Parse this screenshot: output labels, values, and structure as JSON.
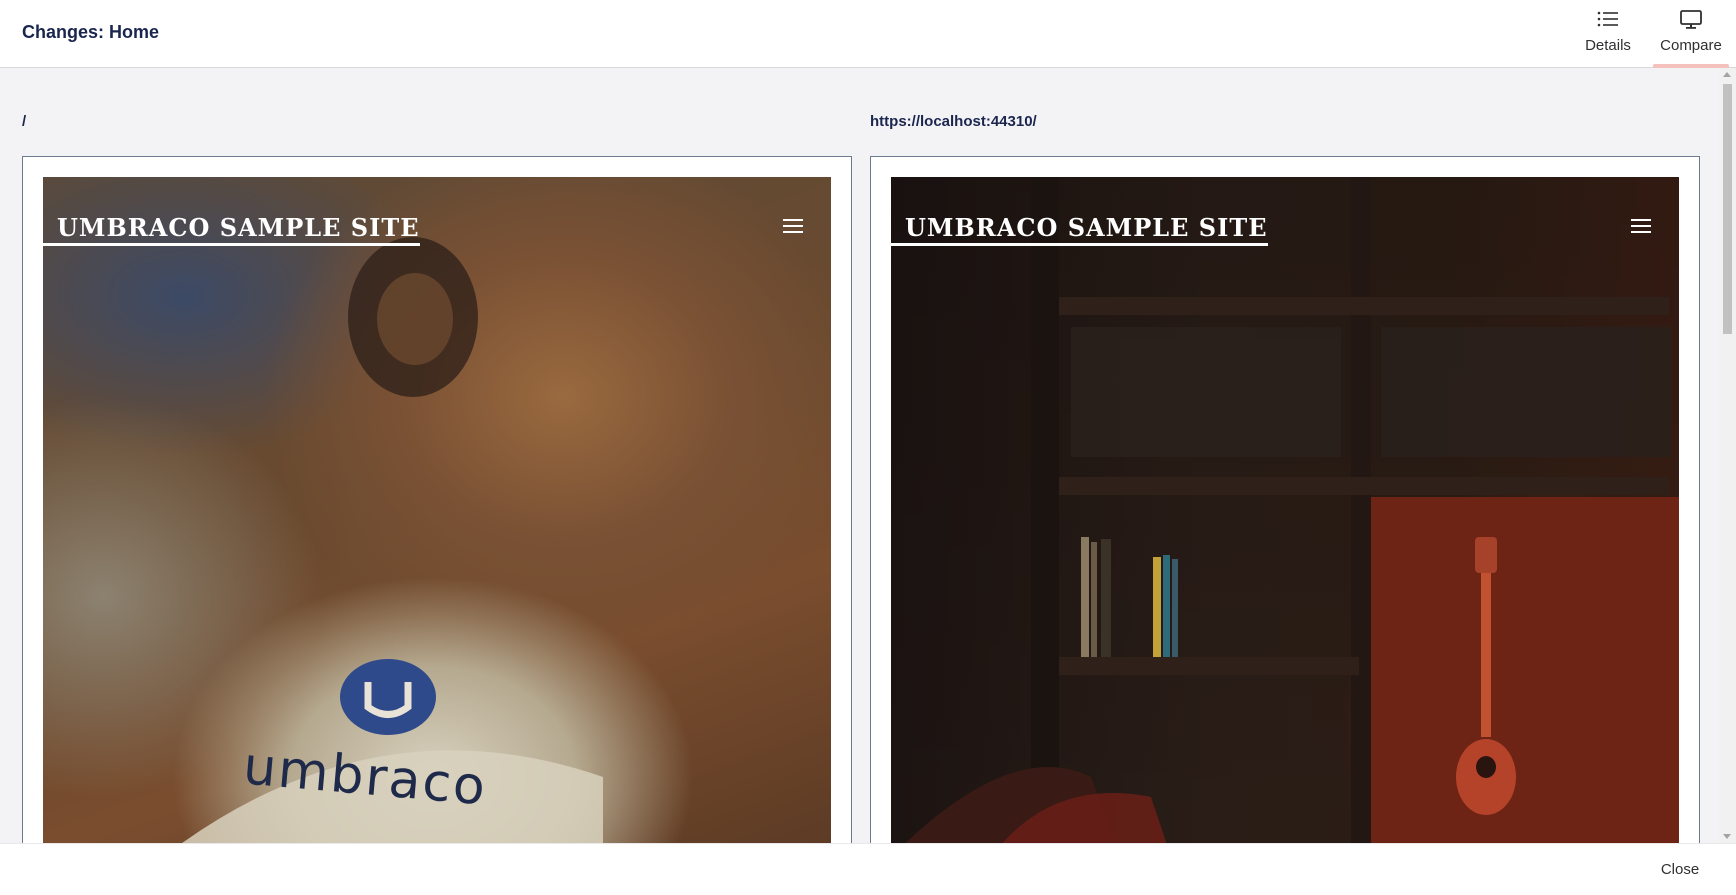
{
  "header": {
    "title": "Changes: Home",
    "tabs": [
      {
        "label": "Details",
        "icon": "list-icon"
      },
      {
        "label": "Compare",
        "icon": "monitor-icon",
        "active": true
      }
    ]
  },
  "compare": {
    "left": {
      "url": "/",
      "site_title": "UMBRACO SAMPLE SITE",
      "logo_text": "umbraco"
    },
    "right": {
      "url": "https://localhost:44310/",
      "site_title": "UMBRACO SAMPLE SITE"
    }
  },
  "footer": {
    "close_label": "Close"
  },
  "colors": {
    "accent_underline": "#f5c1bc",
    "text": "#1b264f",
    "background": "#f3f3f5"
  }
}
